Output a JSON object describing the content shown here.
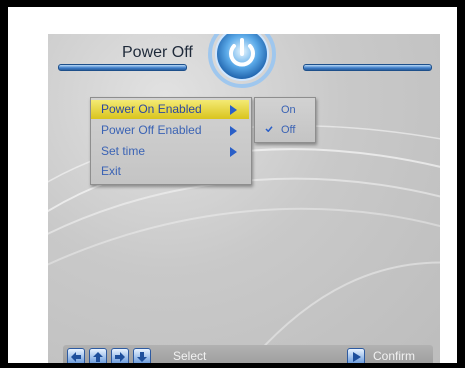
{
  "header": {
    "title": "Power Off"
  },
  "menu": {
    "items": [
      {
        "label": "Power On Enabled",
        "selected": true
      },
      {
        "label": "Power Off Enabled",
        "selected": false
      },
      {
        "label": "Set time",
        "selected": false
      },
      {
        "label": "Exit",
        "selected": false
      }
    ]
  },
  "submenu": {
    "options": [
      {
        "label": "On",
        "checked": false
      },
      {
        "label": "Off",
        "checked": true
      }
    ]
  },
  "footer": {
    "select_label": "Select",
    "confirm_label": "Confirm",
    "icons": [
      "arrow-left-icon",
      "arrow-up-icon",
      "arrow-right-icon",
      "arrow-down-icon",
      "play-icon"
    ]
  },
  "colors": {
    "highlight": "#e8d94a",
    "menu_text": "#3b63b4",
    "accent_blue": "#2a5fc8"
  }
}
